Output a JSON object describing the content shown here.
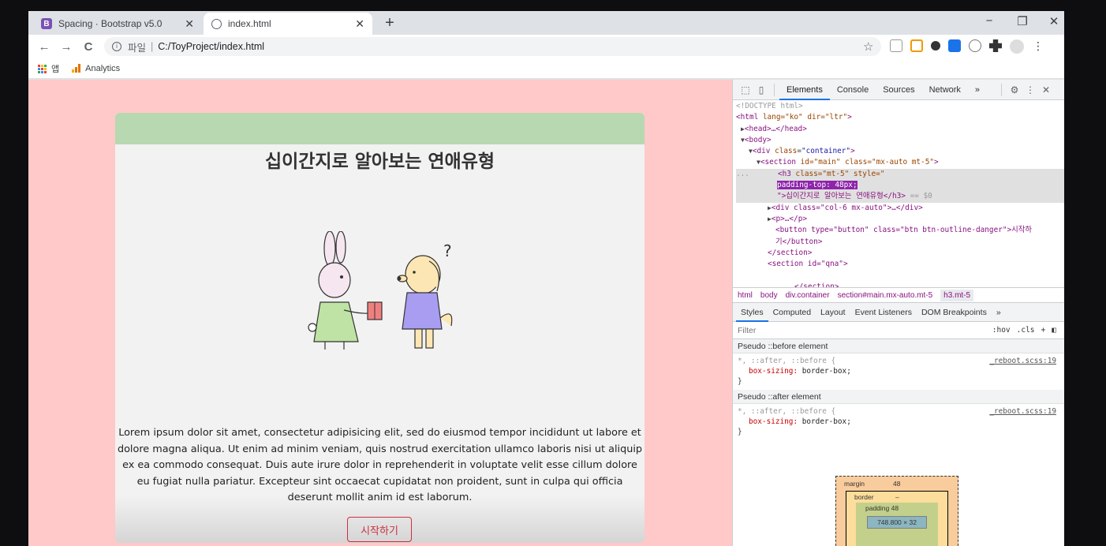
{
  "browser": {
    "tabs": [
      {
        "title": "Spacing · Bootstrap v5.0",
        "icon": "bootstrap-icon",
        "active": false
      },
      {
        "title": "index.html",
        "icon": "globe-icon",
        "active": true
      }
    ],
    "new_tab_symbol": "+",
    "window_controls": {
      "minimize": "−",
      "maximize": "❐",
      "close": "✕"
    },
    "nav": {
      "back": "←",
      "forward": "→",
      "reload": "C"
    },
    "address": {
      "scheme_label": "파일",
      "separator": "|",
      "url": "C:/ToyProject/index.html"
    },
    "star": "☆",
    "bookmarks": [
      {
        "label": "앱",
        "icon": "apps-grid-icon"
      },
      {
        "label": "Analytics",
        "icon": "analytics-bars-icon"
      }
    ],
    "menu": "⋮"
  },
  "page": {
    "title": "십이간지로 알아보는 연애유형",
    "illustration_alt": "rabbit giving gift to puppy",
    "body_text": "Lorem ipsum dolor sit amet, consectetur adipisicing elit, sed do eiusmod tempor incididunt ut labore et dolore magna aliqua. Ut enim ad minim veniam, quis nostrud exercitation ullamco laboris nisi ut aliquip ex ea commodo consequat. Duis aute irure dolor in reprehenderit in voluptate velit esse cillum dolore eu fugiat nulla pariatur. Excepteur sint occaecat cupidatat non proident, sunt in culpa qui officia deserunt mollit anim id est laborum.",
    "start_button": "시작하기",
    "colors": {
      "background": "#ffc9c9",
      "card": "#f2f2f2",
      "green_bar": "#b7d8b0",
      "accent": "#dc3545"
    }
  },
  "devtools": {
    "tabs": [
      "Elements",
      "Console",
      "Sources",
      "Network",
      "»"
    ],
    "active_tab": "Elements",
    "dom": {
      "doctype": "<!DOCTYPE html>",
      "html_open": {
        "tag": "html",
        "attrs": "lang=\"ko\" dir=\"ltr\""
      },
      "head": "<head>…</head>",
      "body": "<body>",
      "div_container": {
        "tag": "div",
        "attr": "class",
        "val": "\"container\""
      },
      "section_main": {
        "tag": "section",
        "attrs": "id=\"main\" class=\"mx-auto mt-5\""
      },
      "h3": {
        "tag": "h3",
        "attrs": "class=\"mt-5\" style=\"",
        "style": "padding-top: 48px;",
        "text": "\">십이간지로 알아보는 연애유형</h3>",
        "eq": "== $0"
      },
      "div_col": "<div class=\"col-6 mx-auto\">…</div>",
      "p": "<p>…</p>",
      "button_line1": "<button type=\"button\" class=\"btn btn-outline-danger\">시작하",
      "button_line2": "기</button>",
      "section_close": "</section>",
      "section_qna": "<section id=\"qna\">",
      "section_qna_close": "</section>",
      "ellipsis": "..."
    },
    "breadcrumbs": [
      "html",
      "body",
      "div.container",
      "section#main.mx-auto.mt-5",
      "h3.mt-5"
    ],
    "sub_tabs": [
      "Styles",
      "Computed",
      "Layout",
      "Event Listeners",
      "DOM Breakpoints",
      "»"
    ],
    "filter_placeholder": "Filter",
    "filter_tools": [
      ":hov",
      ".cls",
      "+",
      "◧"
    ],
    "pseudo_before": "Pseudo ::before element",
    "pseudo_after": "Pseudo ::after element",
    "rule_selector": "*, ::after, ::before {",
    "rule_source": "_reboot.scss:19",
    "rule_prop": "box-sizing",
    "rule_val": "border-box;",
    "rule_close": "}",
    "box_model": {
      "margin_label": "margin",
      "margin_top": "48",
      "border_label": "border",
      "border_val": "–",
      "padding_label": "padding 48",
      "content": "748.800 × 32",
      "dash": "–"
    }
  }
}
